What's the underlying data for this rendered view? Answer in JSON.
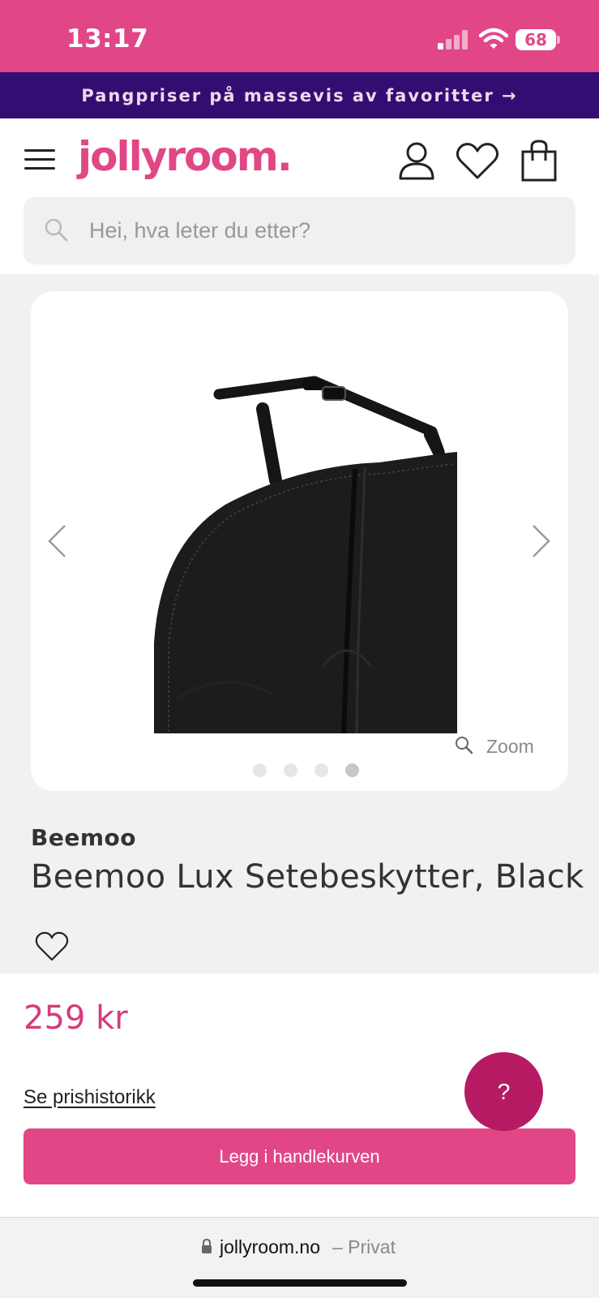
{
  "status_bar": {
    "time": "13:17",
    "battery": "68"
  },
  "promo": {
    "text": "Pangpriser på massevis av favoritter →"
  },
  "header": {
    "logo": "jollyroom."
  },
  "search": {
    "placeholder": "Hei, hva leter du etter?"
  },
  "gallery": {
    "zoom_label": "Zoom",
    "slide_count": 4,
    "active_slide": 4
  },
  "product": {
    "brand": "Beemoo",
    "title": "Beemoo Lux Setebeskytter, Black",
    "price": "259 kr"
  },
  "actions": {
    "price_history": "Se prishistorikk",
    "add_to_cart": "Legg i handlekurven",
    "help": "?"
  },
  "browser": {
    "domain": "jollyroom.no",
    "mode": "– Privat"
  },
  "colors": {
    "brand_pink": "#e14786",
    "promo_purple": "#340d72",
    "help_button": "#b51a62"
  }
}
